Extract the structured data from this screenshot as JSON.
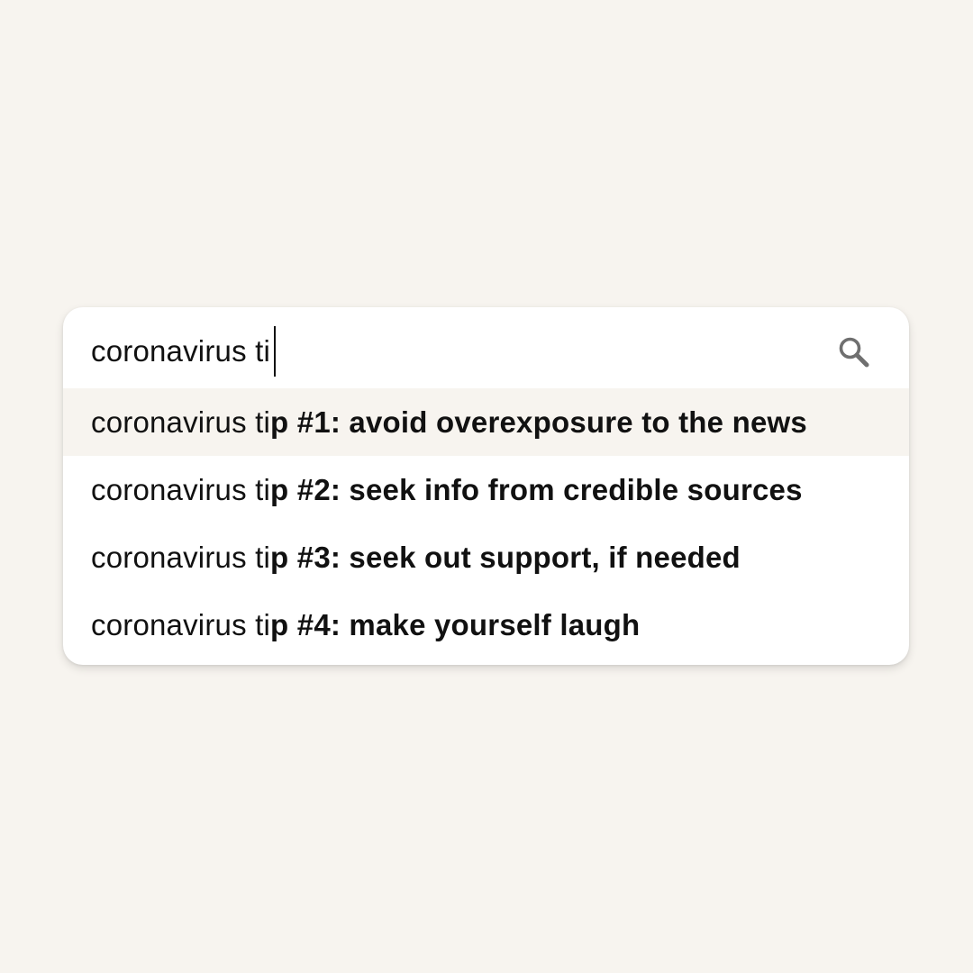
{
  "search": {
    "query": "coronavirus ti",
    "icon": "search-icon"
  },
  "suggestions": [
    {
      "typed": "coronavirus ti",
      "completion": "p #1: avoid overexposure to the news",
      "highlighted": true
    },
    {
      "typed": "coronavirus ti",
      "completion": "p #2: seek info from credible sources",
      "highlighted": false
    },
    {
      "typed": "coronavirus ti",
      "completion": "p #3: seek out support, if needed",
      "highlighted": false
    },
    {
      "typed": "coronavirus ti",
      "completion": "p #4: make yourself laugh",
      "highlighted": false
    }
  ],
  "colors": {
    "background": "#f7f4ef",
    "card": "#ffffff",
    "highlight": "#f7f4ef",
    "text": "#111111",
    "icon": "#6f6f6f"
  }
}
